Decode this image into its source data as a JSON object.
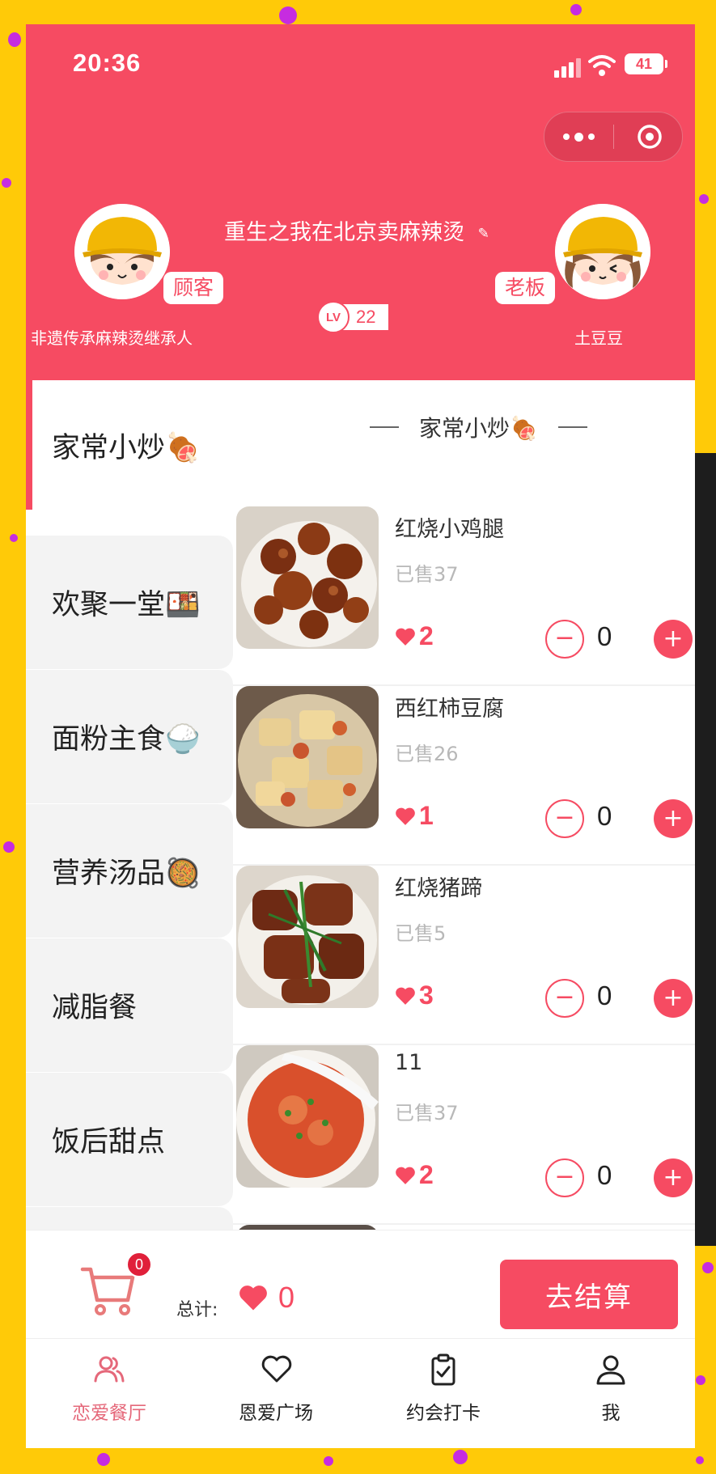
{
  "colors": {
    "accent": "#f64b62",
    "background": "#ffca08"
  },
  "status_bar": {
    "time": "20:36",
    "battery": "41"
  },
  "header": {
    "shop_title": "重生之我在北京卖麻辣烫",
    "level_prefix": "LV",
    "level": "22",
    "customer": {
      "role": "顾客",
      "name": "非遗传承麻辣烫继承人"
    },
    "owner": {
      "role": "老板",
      "name": "土豆豆"
    }
  },
  "sidebar": {
    "items": [
      {
        "label": "家常小炒🍖",
        "active": true
      },
      {
        "label": "欢聚一堂🍱"
      },
      {
        "label": "面粉主食🍚"
      },
      {
        "label": "营养汤品🥘"
      },
      {
        "label": "减脂餐"
      },
      {
        "label": "饭后甜点"
      }
    ]
  },
  "section": {
    "title": "家常小炒🍖"
  },
  "dishes": [
    {
      "name": "红烧小鸡腿",
      "sold": "已售37",
      "likes": "2",
      "qty": "0",
      "image": "braised-chicken-drumsticks"
    },
    {
      "name": "西红柿豆腐",
      "sold": "已售26",
      "likes": "1",
      "qty": "0",
      "image": "tomato-tofu"
    },
    {
      "name": "红烧猪蹄",
      "sold": "已售5",
      "likes": "3",
      "qty": "0",
      "image": "braised-pork-trotters"
    },
    {
      "name": "11",
      "sold": "已售37",
      "likes": "2",
      "qty": "0",
      "image": "tomato-noodle-soup"
    }
  ],
  "cart": {
    "badge": "0",
    "total_label": "总计:",
    "total_value": "0",
    "checkout_label": "去结算"
  },
  "tabbar": {
    "tabs": [
      {
        "label": "恋爱餐厅",
        "icon": "users-icon",
        "active": true
      },
      {
        "label": "恩爱广场",
        "icon": "heart-icon"
      },
      {
        "label": "约会打卡",
        "icon": "clipboard-check-icon"
      },
      {
        "label": "我",
        "icon": "user-icon"
      }
    ]
  }
}
